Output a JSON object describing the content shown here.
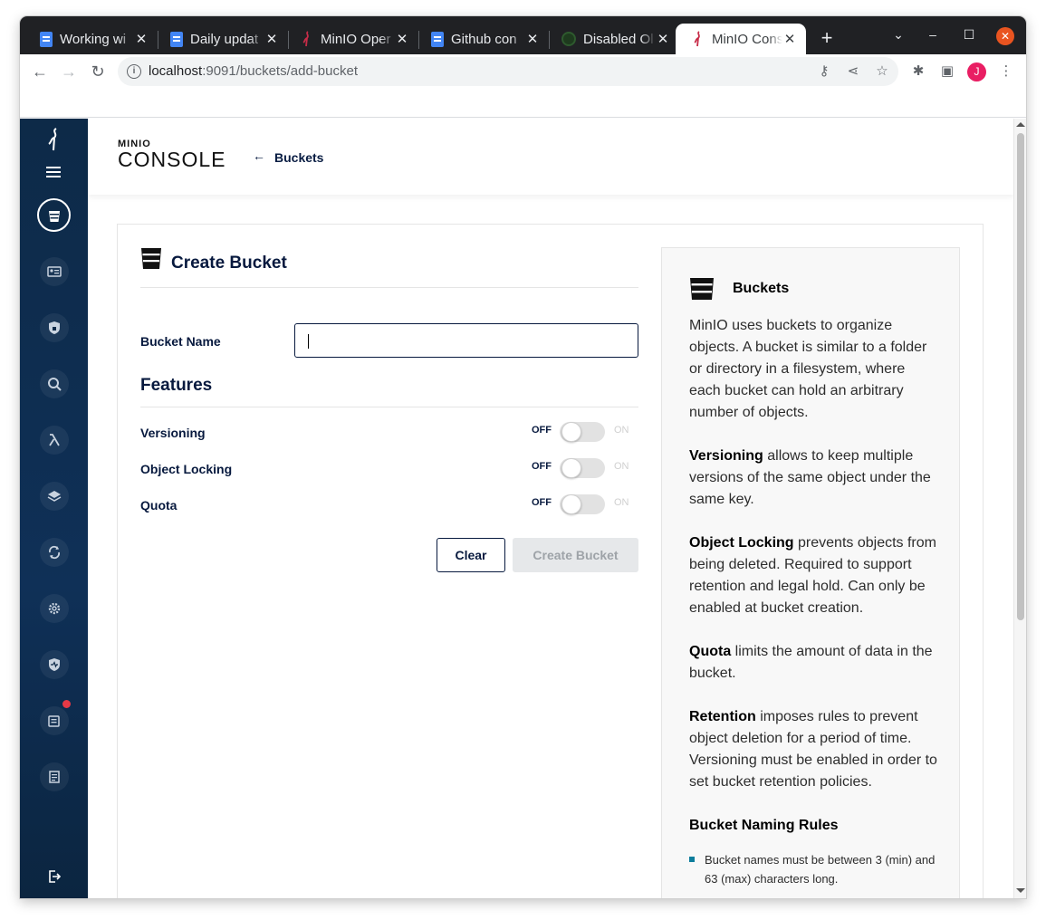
{
  "browser": {
    "tabs": [
      {
        "title": "Working wi",
        "favicon": "google-docs-icon"
      },
      {
        "title": "Daily updat",
        "favicon": "google-docs-icon"
      },
      {
        "title": "MinIO Oper",
        "favicon": "minio-icon"
      },
      {
        "title": "Github con",
        "favicon": "google-docs-icon"
      },
      {
        "title": "Disabled Ol",
        "favicon": "github-icon"
      },
      {
        "title": "MinIO Cons",
        "favicon": "minio-icon"
      }
    ],
    "active_tab": 5,
    "url_host": "localhost",
    "url_path": ":9091/buckets/add-bucket",
    "profile_initial": "J",
    "close_color": "#e95420",
    "profile_color": "#e91e63"
  },
  "sidebar": {
    "items": [
      "buckets",
      "identity",
      "access",
      "monitoring",
      "lambda",
      "tiers",
      "replication",
      "settings",
      "health",
      "support",
      "license"
    ],
    "active": "buckets",
    "badge_color": "#e63946",
    "background": "#0f3057"
  },
  "header": {
    "brand_small": "MINIO",
    "brand_big": "CONSOLE",
    "back_label": "Buckets"
  },
  "form": {
    "title": "Create Bucket",
    "bucket_name_label": "Bucket Name",
    "bucket_name_value": "",
    "features_title": "Features",
    "toggles": [
      {
        "label": "Versioning",
        "off": "OFF",
        "on": "ON",
        "value": false
      },
      {
        "label": "Object Locking",
        "off": "OFF",
        "on": "ON",
        "value": false
      },
      {
        "label": "Quota",
        "off": "OFF",
        "on": "ON",
        "value": false
      }
    ],
    "clear_label": "Clear",
    "create_label": "Create Bucket"
  },
  "help": {
    "title": "Buckets",
    "intro": "MinIO uses buckets to organize objects. A bucket is similar to a folder or directory in a filesystem, where each bucket can hold an arbitrary number of objects.",
    "versioning_term": "Versioning",
    "versioning_text": " allows to keep multiple versions of the same object under the same key.",
    "locking_term": "Object Locking",
    "locking_text": " prevents objects from being deleted. Required to support retention and legal hold. Can only be enabled at bucket creation.",
    "quota_term": "Quota",
    "quota_text": " limits the amount of data in the bucket.",
    "retention_term": "Retention",
    "retention_text": " imposes rules to prevent object deletion for a period of time. Versioning must be enabled in order to set bucket retention policies.",
    "naming_title": "Bucket Naming Rules",
    "naming_rules": [
      "Bucket names must be between 3 (min) and 63 (max) characters long."
    ],
    "accent": "#0d7d9c"
  }
}
